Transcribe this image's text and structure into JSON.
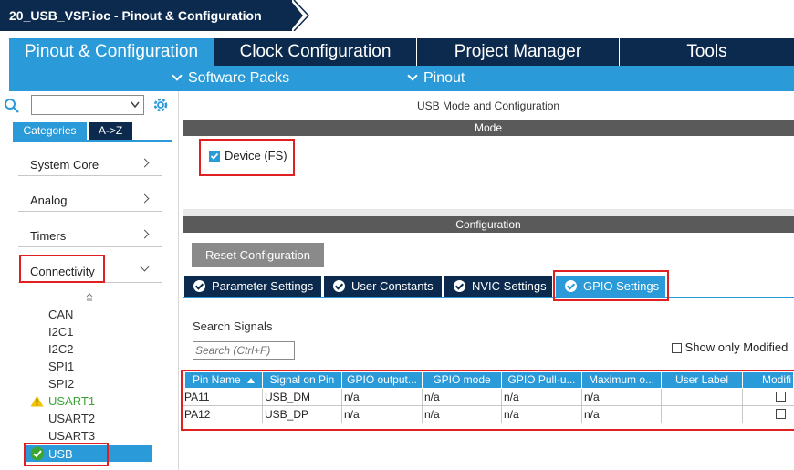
{
  "breadcrumb": {
    "title": "20_USB_VSP.ioc - Pinout & Configuration"
  },
  "main_tabs": [
    {
      "label": "Pinout & Configuration",
      "active": true
    },
    {
      "label": "Clock Configuration",
      "active": false
    },
    {
      "label": "Project Manager",
      "active": false
    },
    {
      "label": "Tools",
      "active": false
    }
  ],
  "subbar": {
    "software_packs": "Software Packs",
    "pinout": "Pinout"
  },
  "sidebar": {
    "tabs": {
      "categories": "Categories",
      "az": "A->Z"
    },
    "categories": [
      {
        "label": "System Core"
      },
      {
        "label": "Analog"
      },
      {
        "label": "Timers"
      },
      {
        "label": "Connectivity"
      }
    ],
    "connectivity_items": [
      {
        "label": "CAN",
        "status": ""
      },
      {
        "label": "I2C1",
        "status": ""
      },
      {
        "label": "I2C2",
        "status": ""
      },
      {
        "label": "SPI1",
        "status": ""
      },
      {
        "label": "SPI2",
        "status": ""
      },
      {
        "label": "USART1",
        "status": "warning"
      },
      {
        "label": "USART2",
        "status": ""
      },
      {
        "label": "USART3",
        "status": ""
      },
      {
        "label": "USB",
        "status": "ok"
      }
    ]
  },
  "content": {
    "title": "USB Mode and Configuration",
    "mode_header": "Mode",
    "device_checkbox": {
      "label": "Device (FS)",
      "checked": true
    },
    "config_header": "Configuration",
    "reset_button": "Reset Configuration",
    "config_tabs": [
      {
        "label": "Parameter Settings",
        "active": false
      },
      {
        "label": "User Constants",
        "active": false
      },
      {
        "label": "NVIC Settings",
        "active": false
      },
      {
        "label": "GPIO Settings",
        "active": true
      }
    ],
    "search_signals_label": "Search Signals",
    "search_placeholder": "Search (Ctrl+F)",
    "show_only_modified": "Show only Modified"
  },
  "gpio_table": {
    "headers": [
      "Pin Name",
      "Signal on Pin",
      "GPIO output...",
      "GPIO mode",
      "GPIO Pull-u...",
      "Maximum o...",
      "User Label",
      "Modifi"
    ],
    "rows": [
      [
        "PA11",
        "USB_DM",
        "n/a",
        "n/a",
        "n/a",
        "n/a",
        "",
        ""
      ],
      [
        "PA12",
        "USB_DP",
        "n/a",
        "n/a",
        "n/a",
        "n/a",
        "",
        ""
      ]
    ]
  },
  "colors": {
    "navy": "#0b2a4e",
    "accent": "#2b9ad8",
    "highlight": "#e02020"
  }
}
